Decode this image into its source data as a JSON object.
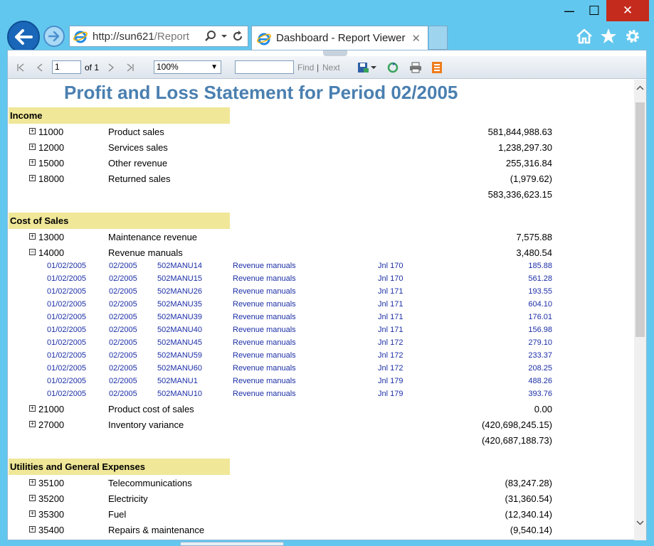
{
  "window": {
    "min": "—",
    "max": "☐",
    "close": "✕"
  },
  "address": {
    "scheme": "http://sun621",
    "path": "/Report"
  },
  "tab": {
    "title": "Dashboard - Report Viewer",
    "close": "✕"
  },
  "toolbar": {
    "page": "1",
    "of": "of 1",
    "zoom": "100%",
    "find": "Find",
    "sep": "|",
    "next": "Next"
  },
  "report": {
    "title": "Profit and Loss Statement for Period 02/2005",
    "income": {
      "header": "Income",
      "rows": [
        {
          "code": "11000",
          "name": "Product sales",
          "amount": "581,844,988.63"
        },
        {
          "code": "12000",
          "name": "Services sales",
          "amount": "1,238,297.30"
        },
        {
          "code": "15000",
          "name": "Other revenue",
          "amount": "255,316.84"
        },
        {
          "code": "18000",
          "name": "Returned sales",
          "amount": "(1,979.62)"
        }
      ],
      "total": "583,336,623.15"
    },
    "cost": {
      "header": "Cost of Sales",
      "rows": [
        {
          "code": "13000",
          "name": "Maintenance revenue",
          "amount": "7,575.88"
        },
        {
          "code": "14000",
          "name": "Revenue manuals",
          "amount": "3,480.54"
        }
      ],
      "details": [
        {
          "date": "01/02/2005",
          "period": "02/2005",
          "ref": "502MANU14",
          "desc": "Revenue manuals",
          "jnl": "Jnl  170",
          "amount": "185.88"
        },
        {
          "date": "01/02/2005",
          "period": "02/2005",
          "ref": "502MANU15",
          "desc": "Revenue manuals",
          "jnl": "Jnl  170",
          "amount": "561.28"
        },
        {
          "date": "01/02/2005",
          "period": "02/2005",
          "ref": "502MANU26",
          "desc": "Revenue manuals",
          "jnl": "Jnl  171",
          "amount": "193.55"
        },
        {
          "date": "01/02/2005",
          "period": "02/2005",
          "ref": "502MANU35",
          "desc": "Revenue manuals",
          "jnl": "Jnl  171",
          "amount": "604.10"
        },
        {
          "date": "01/02/2005",
          "period": "02/2005",
          "ref": "502MANU39",
          "desc": "Revenue manuals",
          "jnl": "Jnl  171",
          "amount": "176.01"
        },
        {
          "date": "01/02/2005",
          "period": "02/2005",
          "ref": "502MANU40",
          "desc": "Revenue manuals",
          "jnl": "Jnl  171",
          "amount": "156.98"
        },
        {
          "date": "01/02/2005",
          "period": "02/2005",
          "ref": "502MANU45",
          "desc": "Revenue manuals",
          "jnl": "Jnl  172",
          "amount": "279.10"
        },
        {
          "date": "01/02/2005",
          "period": "02/2005",
          "ref": "502MANU59",
          "desc": "Revenue manuals",
          "jnl": "Jnl  172",
          "amount": "233.37"
        },
        {
          "date": "01/02/2005",
          "period": "02/2005",
          "ref": "502MANU60",
          "desc": "Revenue manuals",
          "jnl": "Jnl  172",
          "amount": "208.25"
        },
        {
          "date": "01/02/2005",
          "period": "02/2005",
          "ref": "502MANU1",
          "desc": "Revenue manuals",
          "jnl": "Jnl  179",
          "amount": "488.26"
        },
        {
          "date": "01/02/2005",
          "period": "02/2005",
          "ref": "502MANU10",
          "desc": "Revenue manuals",
          "jnl": "Jnl  179",
          "amount": "393.76"
        }
      ],
      "rows2": [
        {
          "code": "21000",
          "name": "Product cost of sales",
          "amount": "0.00"
        },
        {
          "code": "27000",
          "name": "Inventory variance",
          "amount": "(420,698,245.15)"
        }
      ],
      "total": "(420,687,188.73)"
    },
    "utilities": {
      "header": "Utilities and General Expenses",
      "rows": [
        {
          "code": "35100",
          "name": "Telecommunications",
          "amount": "(83,247.28)"
        },
        {
          "code": "35200",
          "name": "Electricity",
          "amount": "(31,360.54)"
        },
        {
          "code": "35300",
          "name": "Fuel",
          "amount": "(12,340.14)"
        },
        {
          "code": "35400",
          "name": "Repairs & maintenance",
          "amount": "(9,540.14)"
        }
      ]
    },
    "expand_glyph": "+",
    "collapse_glyph": "−"
  },
  "colors": {
    "title": "#4a7fb0",
    "section_bg": "#f0e798",
    "detail_text": "#1c2fa6",
    "chrome": "#62c7ee"
  }
}
